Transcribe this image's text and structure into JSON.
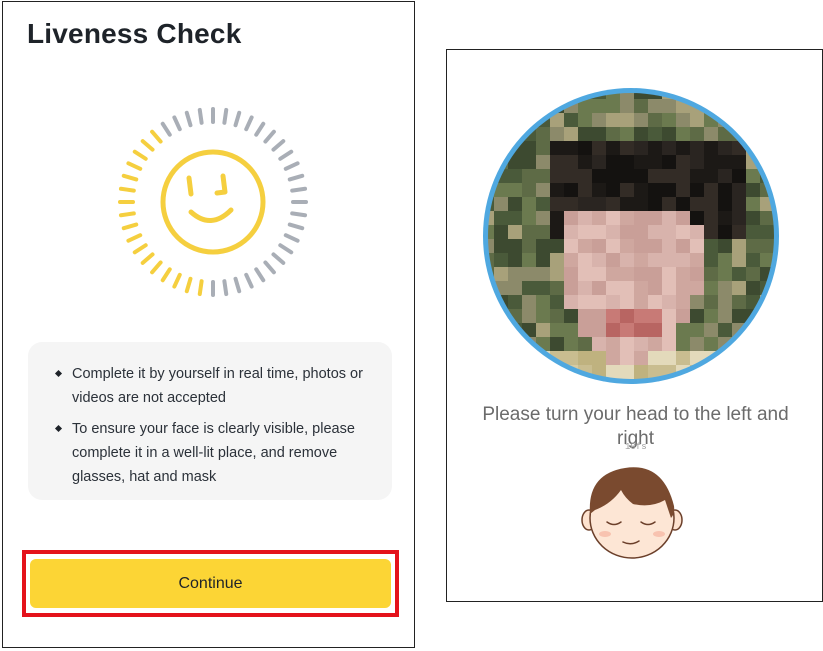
{
  "left_screen": {
    "title": "Liveness Check",
    "icon": "smiley-face-icon",
    "instructions": [
      "Complete it by yourself in real time, photos or videos are not accepted",
      "To ensure your face is clearly visible, please complete it in a well-lit place, and remove glasses, hat and mask"
    ],
    "continue_label": "Continue",
    "colors": {
      "accent": "#fcd535",
      "smiley": "#f5cf3f",
      "dash_gray": "#a9aeb6",
      "dash_yellow": "#f5cf3f",
      "highlight": "#e4121b"
    }
  },
  "right_screen": {
    "camera_preview": "pixelated-face-camera-preview",
    "instruction": "Please turn your head to the left and right",
    "fps_label": "10fs",
    "avatar": "cartoon-head-avatar-icon",
    "colors": {
      "ring": "#4fa8e0",
      "text": "#6b6b6b"
    }
  }
}
